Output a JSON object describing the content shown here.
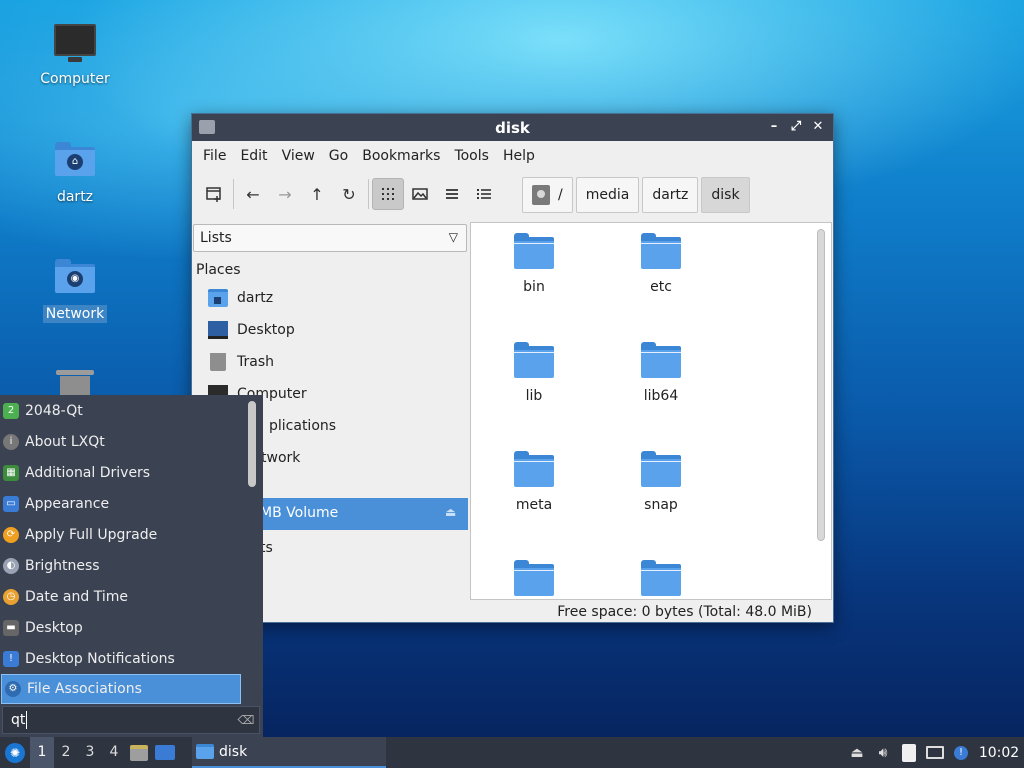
{
  "desktop": {
    "icons": [
      {
        "label": "Computer",
        "icon": "computer-icon"
      },
      {
        "label": "dartz",
        "icon": "home-folder-icon"
      },
      {
        "label": "Network",
        "icon": "network-folder-icon"
      },
      {
        "label": "",
        "icon": "trash-icon"
      }
    ]
  },
  "window": {
    "title": "disk",
    "controls": {
      "minimize": "–",
      "maximize": "⤢",
      "close": "✕"
    },
    "menu": [
      "File",
      "Edit",
      "View",
      "Go",
      "Bookmarks",
      "Tools",
      "Help"
    ],
    "breadcrumbs": [
      "/",
      "media",
      "dartz",
      "disk"
    ],
    "side_panel": {
      "mode": "Lists",
      "places_header": "Places",
      "places": [
        "dartz",
        "Desktop",
        "Trash",
        "Computer",
        "plications",
        "twork"
      ],
      "volume": "MB Volume",
      "extra": "ts"
    },
    "files": [
      "bin",
      "etc",
      "lib",
      "lib64",
      "meta",
      "snap",
      "",
      ""
    ],
    "status": "Free space: 0 bytes (Total: 48.0 MiB)"
  },
  "app_menu": {
    "items": [
      {
        "label": "2048-Qt",
        "color": "#4caf50",
        "glyph": "2"
      },
      {
        "label": "About LXQt",
        "color": "#777777",
        "glyph": "i"
      },
      {
        "label": "Additional Drivers",
        "color": "#3d8b3d",
        "glyph": "▦"
      },
      {
        "label": "Appearance",
        "color": "#3a7bd5",
        "glyph": "▭"
      },
      {
        "label": "Apply Full Upgrade",
        "color": "#f0a020",
        "glyph": "⟳"
      },
      {
        "label": "Brightness",
        "color": "#9aa3b3",
        "glyph": "◐"
      },
      {
        "label": "Date and Time",
        "color": "#e8a030",
        "glyph": "◷"
      },
      {
        "label": "Desktop",
        "color": "#666666",
        "glyph": "▬"
      },
      {
        "label": "Desktop Notifications",
        "color": "#3a7bd5",
        "glyph": "!"
      },
      {
        "label": "File Associations",
        "color": "#4a90d9",
        "glyph": "⚙"
      }
    ],
    "selected_index": 9,
    "search_value": "qt"
  },
  "taskbar": {
    "workspaces": [
      "1",
      "2",
      "3",
      "4"
    ],
    "active_workspace": "1",
    "task_label": "disk",
    "clock": "10:02"
  }
}
